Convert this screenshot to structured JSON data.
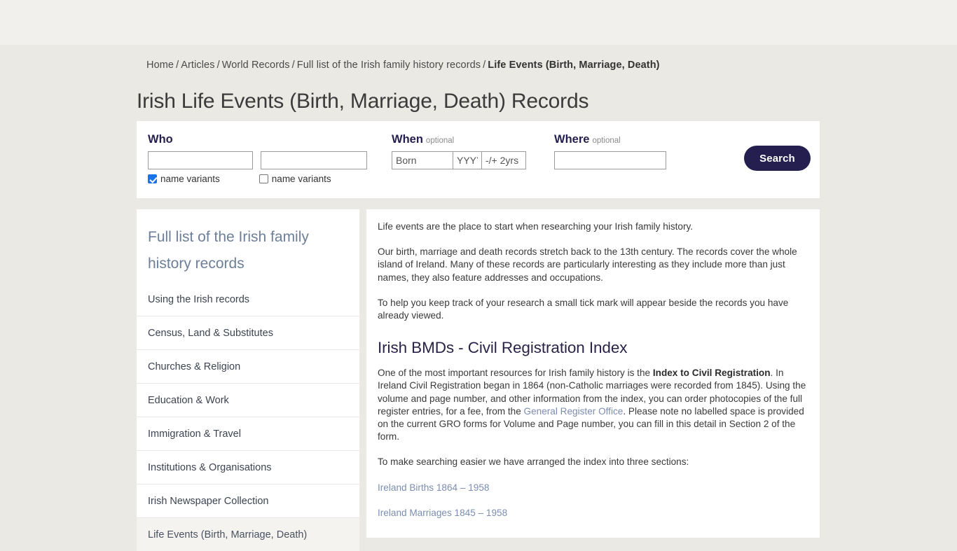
{
  "theme": {
    "page_bg": "#ebe9e3",
    "top_band_bg": "#f2f0ec",
    "panel_bg": "#ffffff",
    "accent_navy": "#241f4e",
    "link_blue": "#7b8db0",
    "sidebar_heading": "#6d7f98",
    "checkbox_blue": "#1a73e8"
  },
  "breadcrumb": {
    "items": [
      {
        "label": "Home",
        "current": false
      },
      {
        "label": "Articles",
        "current": false
      },
      {
        "label": "World Records",
        "current": false
      },
      {
        "label": "Full list of the Irish family history records",
        "current": false
      },
      {
        "label": "Life Events (Birth, Marriage, Death)",
        "current": true
      }
    ],
    "separator": "/"
  },
  "page_title": "Irish Life Events (Birth, Marriage, Death) Records",
  "search_form": {
    "who": {
      "label": "Who",
      "first_name": {
        "value": "",
        "placeholder": ""
      },
      "last_name": {
        "value": "",
        "placeholder": ""
      },
      "variant_first": {
        "label": "name variants",
        "checked": true
      },
      "variant_last": {
        "label": "name variants",
        "checked": false
      }
    },
    "when": {
      "label": "When",
      "optional": "optional",
      "event": {
        "value": "",
        "placeholder": "Born"
      },
      "year": {
        "value": "",
        "placeholder": "YYYY"
      },
      "range": {
        "value": "",
        "placeholder": "-/+ 2yrs"
      }
    },
    "where": {
      "label": "Where",
      "optional": "optional",
      "place": {
        "value": "",
        "placeholder": ""
      }
    },
    "submit_label": "Search"
  },
  "sidebar": {
    "title": "Full list of the Irish family history records",
    "items": [
      {
        "label": "Using the Irish records",
        "active": false
      },
      {
        "label": "Census, Land & Substitutes",
        "active": false
      },
      {
        "label": "Churches & Religion",
        "active": false
      },
      {
        "label": "Education & Work",
        "active": false
      },
      {
        "label": "Immigration & Travel",
        "active": false
      },
      {
        "label": "Institutions & Organisations",
        "active": false
      },
      {
        "label": "Irish Newspaper Collection",
        "active": false
      },
      {
        "label": "Life Events (Birth, Marriage, Death)",
        "active": true
      }
    ]
  },
  "content": {
    "intro": "Life events are the place to start when researching your Irish family history.",
    "paragraph_2": "Our birth, marriage and death records stretch back to the 13th century. The records cover the whole island of Ireland. Many of these records are particularly interesting as they include more than just names, they also feature addresses and occupations.",
    "paragraph_3": "To help you keep track of your research a small tick mark will appear beside the records you have already viewed.",
    "section_heading": "Irish BMDs - Civil Registration Index",
    "body_part_1": "One of the most important resources for Irish family history is the ",
    "body_bold": "Index to Civil Registration",
    "body_part_2": ". In Ireland Civil Registration began in 1864 (non-Catholic marriages were recorded from 1845). Using the volume and page number, and other information from the index, you can order photocopies of the full register entries, for a fee, from the ",
    "body_link": "General Register Office",
    "body_part_3": ". Please note no labelled space is provided on the current GRO forms for Volume and Page number, you can fill in this detail in Section 2 of the form.",
    "sections_intro": "To make searching easier we have arranged the index into three sections:",
    "section_links": [
      "Ireland Births 1864 – 1958",
      "Ireland Marriages 1845 – 1958"
    ]
  }
}
